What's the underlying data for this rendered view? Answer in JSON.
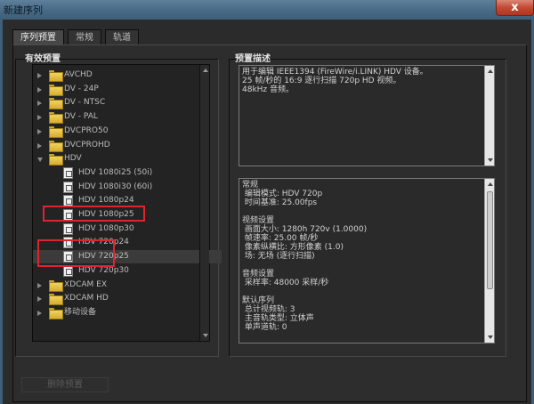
{
  "window": {
    "title": "新建序列",
    "close_glyph": "x"
  },
  "tabs": [
    {
      "label": "序列预置",
      "active": true
    },
    {
      "label": "常规",
      "active": false
    },
    {
      "label": "轨道",
      "active": false
    }
  ],
  "presets": {
    "label": "有效预置",
    "items": [
      {
        "type": "folder",
        "label": "AVCHD",
        "expanded": false
      },
      {
        "type": "folder",
        "label": "DV - 24P",
        "expanded": false
      },
      {
        "type": "folder",
        "label": "DV - NTSC",
        "expanded": false
      },
      {
        "type": "folder",
        "label": "DV - PAL",
        "expanded": false
      },
      {
        "type": "folder",
        "label": "DVCPRO50",
        "expanded": false
      },
      {
        "type": "folder",
        "label": "DVCPROHD",
        "expanded": false
      },
      {
        "type": "folder",
        "label": "HDV",
        "expanded": true
      },
      {
        "type": "preset",
        "label": "HDV 1080i25 (50i)"
      },
      {
        "type": "preset",
        "label": "HDV 1080i30 (60i)"
      },
      {
        "type": "preset",
        "label": "HDV 1080p24"
      },
      {
        "type": "preset",
        "label": "HDV 1080p25"
      },
      {
        "type": "preset",
        "label": "HDV 1080p30"
      },
      {
        "type": "preset",
        "label": "HDV 720p24"
      },
      {
        "type": "preset",
        "label": "HDV 720p25",
        "selected": true
      },
      {
        "type": "preset",
        "label": "HDV 720p30"
      },
      {
        "type": "folder",
        "label": "XDCAM EX",
        "expanded": false
      },
      {
        "type": "folder",
        "label": "XDCAM HD",
        "expanded": false
      },
      {
        "type": "folder",
        "label": "移动设备",
        "expanded": false
      }
    ]
  },
  "description": {
    "label": "预置描述",
    "summary": "用于编辑 IEEE1394 (FireWire/i.LINK) HDV 设备。\n25 帧/秒的 16:9 逐行扫描 720p HD 视频。\n48kHz 音频。",
    "details": "常规\n 编辑模式: HDV 720p\n 时间基准: 25.00fps\n\n视频设置\n 画面大小: 1280h 720v (1.0000)\n 帧速率: 25.00 帧/秒\n 像素纵横比: 方形像素 (1.0)\n 场: 无场 (逐行扫描)\n\n音频设置\n 采样率: 48000 采样/秒\n\n默认序列\n 总计视频轨: 3\n 主音轨类型: 立体声\n 单声道轨: 0"
  },
  "delete_preset_label": "删除预置",
  "colors": {
    "highlight": "#e0242e",
    "title_bar": "#466883",
    "background": "#2d2d2d"
  }
}
